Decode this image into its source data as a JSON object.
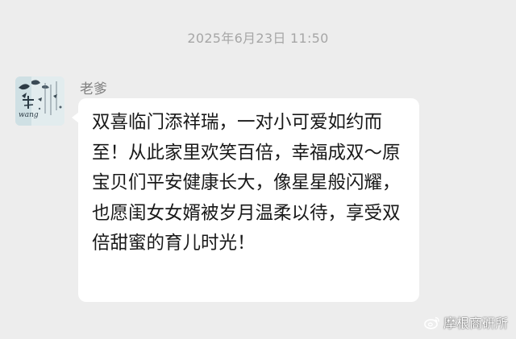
{
  "timestamp": "2025年6月23日 11:50",
  "sender": {
    "name": "老爹",
    "avatar_text": "wang"
  },
  "message": {
    "text": "双喜临门添祥瑞，一对小可爱如约而至！从此家里欢笑百倍，幸福成双～原宝贝们平安健康长大，像星星般闪耀，也愿闺女女婿被岁月温柔以待，享受双倍甜蜜的育儿时光！"
  },
  "watermark": {
    "icon": "weibo-icon",
    "text": "摩根商研所"
  },
  "colors": {
    "background": "#ededed",
    "bubble": "#ffffff",
    "timestamp": "#a6a6a6",
    "sender_name": "#7f7f7f",
    "message_text": "#191919"
  }
}
